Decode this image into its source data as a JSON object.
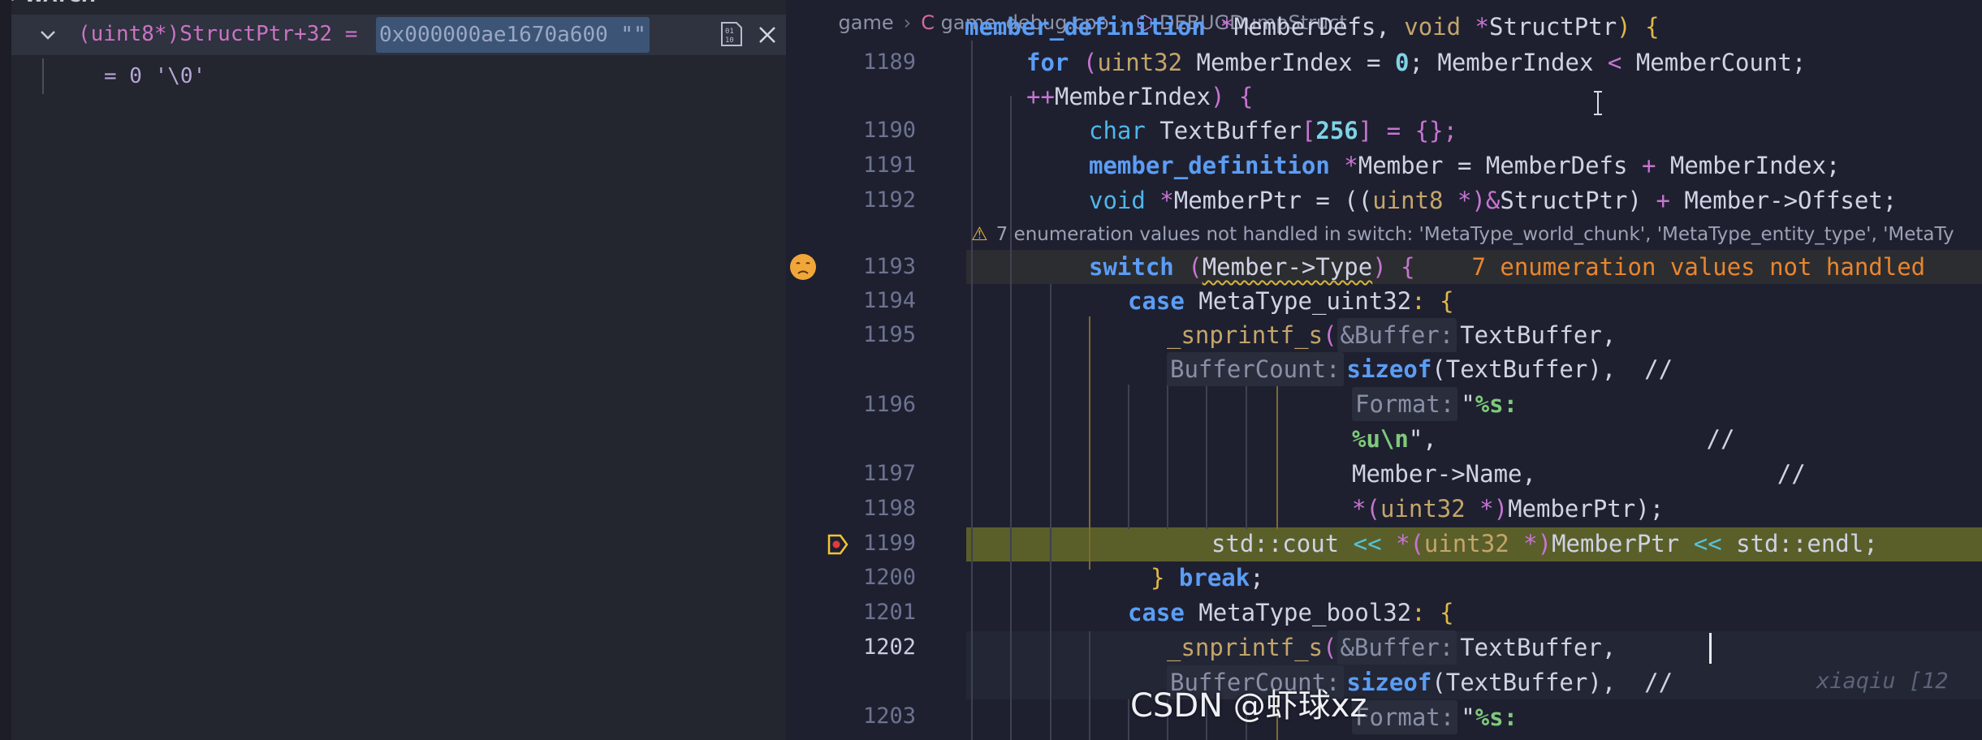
{
  "watch": {
    "header": "WATCH",
    "expression": "(uint8*)StructPtr+32 = ",
    "value": "0x000000ae1670a600 \"\"",
    "child_value": "= 0 '\\0'"
  },
  "breadcrumb": {
    "folder": "game",
    "file": "game_debug.cpp",
    "symbol": "DEBUGDumpStruct"
  },
  "warning": {
    "text": "7 enumeration values not handled in switch: 'MetaType_world_chunk', 'MetaType_entity_type', 'MetaTy"
  },
  "inline_error": "7 enumeration values not handled",
  "line_numbers": {
    "l1189": "1189",
    "l1190": "1190",
    "l1191": "1191",
    "l1192": "1192",
    "l1193": "1193",
    "l1194": "1194",
    "l1195": "1195",
    "l1196": "1196",
    "l1197": "1197",
    "l1198": "1198",
    "l1199": "1199",
    "l1200": "1200",
    "l1201": "1201",
    "l1202": "1202",
    "l1203": "1203"
  },
  "code": {
    "l1188": {
      "t1": "member_definition",
      "t2": " *",
      "t3": "MemberDefs, ",
      "t4": "void",
      "t5": " *",
      "t6": "StructPtr",
      "t7": ") {"
    },
    "l1189a": {
      "t1": "for",
      "t2": " (",
      "t3": "uint32",
      "t4": " MemberIndex = ",
      "t5": "0",
      "t6": "; MemberIndex ",
      "t7": "<",
      "t8": " MemberCount;"
    },
    "l1189b": {
      "t1": "++",
      "t2": "MemberIndex",
      "t3": ") {"
    },
    "l1190": {
      "t1": "char",
      "t2": " TextBuffer",
      "t3": "[",
      "t4": "256",
      "t5": "] = {};"
    },
    "l1191": {
      "t1": "member_definition",
      "t2": " *",
      "t3": "Member = MemberDefs ",
      "t4": "+",
      "t5": " MemberIndex;"
    },
    "l1192": {
      "t1": "void",
      "t2": " *",
      "t3": "MemberPtr = ((",
      "t4": "uint8",
      "t5": " *)",
      "t6": "&",
      "t7": "StructPtr) ",
      "t8": "+",
      "t9": " Member->Offset;"
    },
    "l1193": {
      "t1": "switch",
      "t2": " (",
      "t3": "Member->Type",
      "t4": ") {"
    },
    "l1194": {
      "t1": "case",
      "t2": " MetaType_uint32",
      "t3": ": {"
    },
    "l1195a": {
      "t1": "_snprintf_s",
      "t2": "(",
      "h1": "&Buffer:",
      "t3": "TextBuffer,"
    },
    "l1195b": {
      "h1": "BufferCount:",
      "t1": "sizeof",
      "t2": "(TextBuffer),",
      "t3": "  //"
    },
    "l1196a": {
      "h1": "Format:",
      "t1": "\"",
      "t2": "%s:"
    },
    "l1196b": {
      "t1": "%u\\n",
      "t2": "\",",
      "t3": "                   //"
    },
    "l1197": {
      "t1": "Member->Name,",
      "t2": "                 //"
    },
    "l1198": {
      "t1": "*",
      "t2": "(",
      "t3": "uint32",
      "t4": " *)",
      "t5": "MemberPtr);"
    },
    "l1199": {
      "t1": "std::cout ",
      "t2": "<<",
      "t3": " *",
      "t4": "(",
      "t5": "uint32",
      "t6": " *)",
      "t7": "MemberPtr ",
      "t8": "<<",
      "t9": " std::endl;"
    },
    "l1200": {
      "t1": "}",
      "t2": " break",
      "t3": ";"
    },
    "l1201": {
      "t1": "case",
      "t2": " MetaType_bool32",
      "t3": ": {"
    },
    "l1202a": {
      "t1": "_snprintf_s",
      "t2": "(",
      "h1": "&Buffer:",
      "t3": "TextBuffer,"
    },
    "l1202b": {
      "h1": "BufferCount:",
      "t1": "sizeof",
      "t2": "(TextBuffer),",
      "t3": "  //"
    },
    "l1203": {
      "h1": "Format:",
      "t1": "\"",
      "t2": "%s:"
    }
  },
  "blame": "xiaqiu [12",
  "watermark": "CSDN @虾球xz",
  "colors": {
    "breakpoint_line": "#5a5f2a",
    "warning": "#e2b23a",
    "error_text": "#e9852e",
    "keyword": "#5b9df5",
    "type": "#c4a56a"
  }
}
